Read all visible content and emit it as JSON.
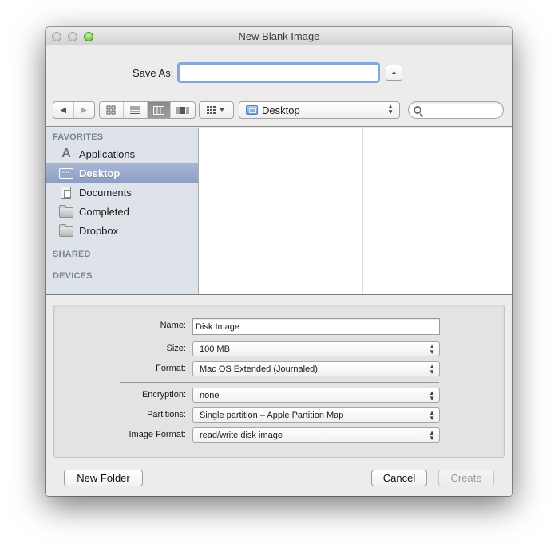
{
  "window": {
    "title": "New Blank Image",
    "traffic_lights": [
      "close",
      "minimize",
      "zoom"
    ]
  },
  "save_as": {
    "label": "Save As:",
    "value": "",
    "expand_icon": "triangle-up"
  },
  "toolbar": {
    "back_icon": "◀",
    "forward_icon": "▶",
    "view_modes": [
      {
        "name": "icon-view",
        "glyph": "▫▫",
        "active": false
      },
      {
        "name": "list-view",
        "glyph": "☰",
        "active": false
      },
      {
        "name": "column-view",
        "glyph": "▥",
        "active": true
      },
      {
        "name": "cover-flow-view",
        "glyph": "▮▮",
        "active": false
      }
    ],
    "arrange_glyph": "▦ ▾",
    "location": "Desktop",
    "search_placeholder": ""
  },
  "sidebar": {
    "sections": [
      {
        "title": "FAVORITES",
        "items": [
          {
            "label": "Applications",
            "icon": "applications-icon",
            "selected": false
          },
          {
            "label": "Desktop",
            "icon": "desktop-icon",
            "selected": true
          },
          {
            "label": "Documents",
            "icon": "documents-icon",
            "selected": false
          },
          {
            "label": "Completed",
            "icon": "folder-icon",
            "selected": false
          },
          {
            "label": "Dropbox",
            "icon": "folder-icon",
            "selected": false
          }
        ]
      },
      {
        "title": "SHARED",
        "items": []
      },
      {
        "title": "DEVICES",
        "items": []
      }
    ]
  },
  "options": {
    "name_label": "Name:",
    "name_value": "Disk Image",
    "size_label": "Size:",
    "size_value": "100 MB",
    "format_label": "Format:",
    "format_value": "Mac OS Extended (Journaled)",
    "encryption_label": "Encryption:",
    "encryption_value": "none",
    "partitions_label": "Partitions:",
    "partitions_value": "Single partition – Apple Partition Map",
    "image_format_label": "Image Format:",
    "image_format_value": "read/write disk image"
  },
  "buttons": {
    "new_folder": "New Folder",
    "cancel": "Cancel",
    "create": "Create",
    "create_enabled": false
  }
}
